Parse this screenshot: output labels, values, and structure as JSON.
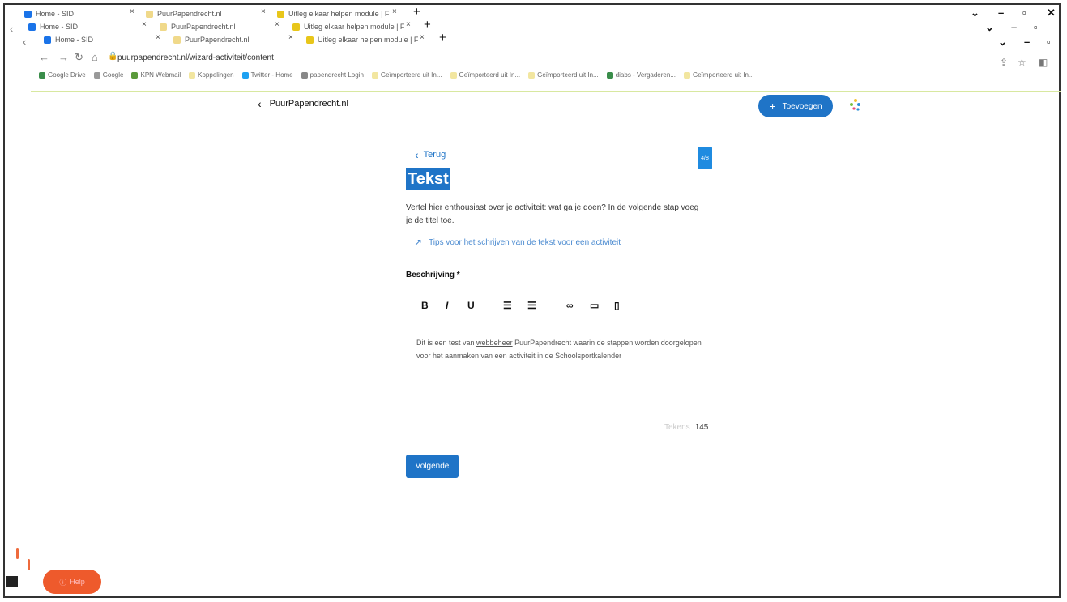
{
  "browser": {
    "tabs_row1": [
      {
        "label": "Home - SID",
        "favicon": "sid-icon"
      },
      {
        "label": "PuurPapendrecht.nl",
        "favicon": "puur-icon"
      },
      {
        "label": "Uitleg elkaar helpen module | F",
        "favicon": "uitleg-icon"
      }
    ],
    "tabs_row2": [
      {
        "label": "Home - SID",
        "favicon": "sid-icon"
      },
      {
        "label": "PuurPapendrecht.nl",
        "favicon": "puur-icon"
      },
      {
        "label": "Uitleg elkaar helpen module | F",
        "favicon": "uitleg-icon"
      }
    ],
    "tabs_row3": [
      {
        "label": "Home - SID",
        "favicon": "sid-icon"
      },
      {
        "label": "PuurPapendrecht.nl",
        "favicon": "puur-icon"
      },
      {
        "label": "Uitleg elkaar helpen module | F",
        "favicon": "uitleg-icon"
      }
    ],
    "close_glyph": "×",
    "new_tab_glyph": "+",
    "url": "puurpapendrecht.nl/wizard-activiteit/content",
    "bookmarks": [
      "Google Drive",
      "Google",
      "KPN Webmail",
      "Koppelingen",
      "Twitter - Home",
      "papendrecht Login",
      "Geïmporteerd uit In...",
      "Geïmporteerd uit In...",
      "Geïmporteerd uit In...",
      "diabs - Vergaderen...",
      "Geïmporteerd uit In..."
    ]
  },
  "app": {
    "site_name": "PuurPapendrecht.nl",
    "add_button": "Toevoegen",
    "back_link": "Terug",
    "step_indicator": "4/8",
    "page_title": "Tekst",
    "intro_text": "Vertel hier enthousiast over je activiteit: wat ga je doen? In de volgende stap voeg je de titel toe.",
    "tips_link": "Tips voor het schrijven van de tekst voor een activiteit",
    "field_label": "Beschrijving *",
    "editor_content_before": "Dit is een test van ",
    "editor_content_link": "webbeheer",
    "editor_content_after": " PuurPapendrecht waarin de stappen worden doorgelopen voor het aanmaken van een activiteit in de Schoolsportkalender",
    "counter_label": "Tekens",
    "counter_value": "145",
    "next_button": "Volgende",
    "help_button": "Help"
  },
  "colors": {
    "accent": "#1f74c7",
    "help": "#ee5a2c"
  }
}
